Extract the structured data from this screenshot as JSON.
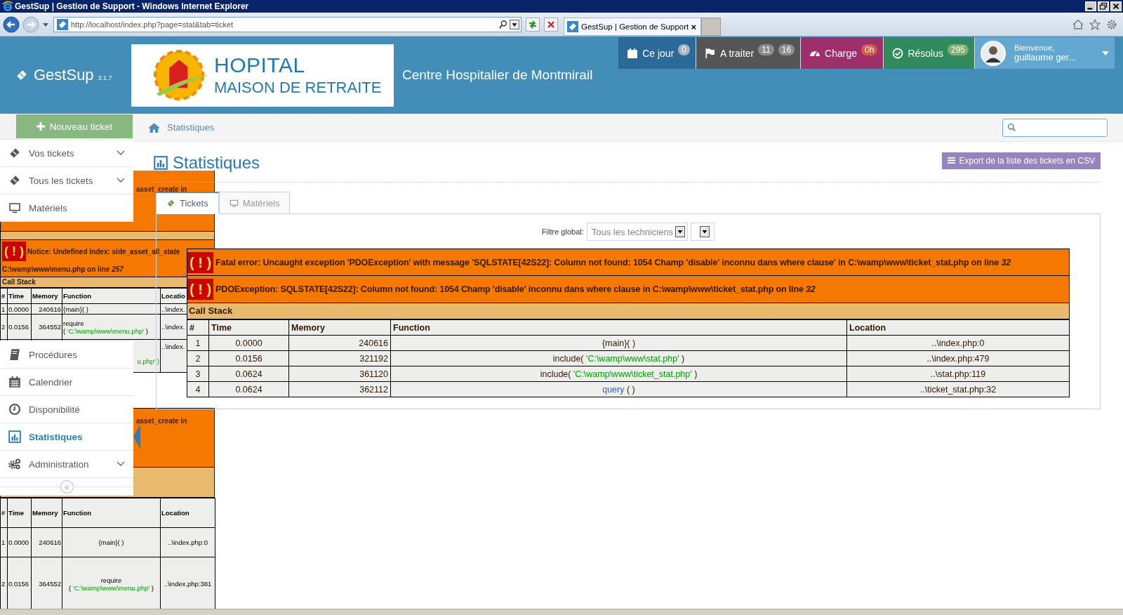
{
  "browser": {
    "title": "GestSup | Gestion de Support - Windows Internet Explorer",
    "address": "http://localhost/index.php?page=stat&tab=ticket",
    "tab": {
      "label": "GestSup | Gestion de Support",
      "close": "×"
    }
  },
  "header": {
    "app_name": "GestSup",
    "version": "3.1.7",
    "logo": {
      "line_1": "HOPITAL",
      "line_2": "MAISON DE RETRAITE"
    },
    "site_title": "Centre Hospitalier de Montmirail"
  },
  "nav": [
    {
      "label": "Ce jour",
      "kind": "calendar",
      "color": "#2b6a98",
      "badges": [
        {
          "text": "0",
          "color": "#a6b4c2"
        }
      ]
    },
    {
      "label": "A traiter",
      "kind": "flag",
      "color": "#555555",
      "badges": [
        {
          "text": "11",
          "color": "#8c8c8c"
        },
        {
          "text": "16",
          "color": "#8c8c8c"
        }
      ]
    },
    {
      "label": "Charge",
      "kind": "gauge",
      "color": "#9e2f6b",
      "badges": [
        {
          "text": "0h",
          "color": "#d15b47"
        }
      ]
    },
    {
      "label": "Résolus",
      "kind": "check",
      "color": "#2f8a5e",
      "badges": [
        {
          "text": "295",
          "color": "#82af6f"
        }
      ]
    }
  ],
  "user": {
    "greeting": "Bienvenue,",
    "name": "guillaume ger..."
  },
  "sidebar": {
    "new_ticket": "Nouveau ticket",
    "items_top": [
      {
        "label": "Vos tickets",
        "kind": "ticket",
        "expandable": true,
        "selected": false
      },
      {
        "label": "Tous les tickets",
        "kind": "ticket",
        "expandable": true,
        "selected": false
      },
      {
        "label": "Matériels",
        "kind": "monitor",
        "expandable": false,
        "selected": false
      }
    ],
    "items_bottom": [
      {
        "label": "Procédures",
        "kind": "book",
        "expandable": false,
        "selected": false
      },
      {
        "label": "Calendrier",
        "kind": "calendar",
        "expandable": false,
        "selected": false
      },
      {
        "label": "Disponibilité",
        "kind": "clock",
        "expandable": false,
        "selected": false
      },
      {
        "label": "Statistiques",
        "kind": "chart",
        "expandable": false,
        "selected": true
      },
      {
        "label": "Administration",
        "kind": "gears",
        "expandable": true,
        "selected": false
      }
    ],
    "collapse": "«"
  },
  "breadcrumb": {
    "link": "Statistiques"
  },
  "page": {
    "title": "Statistiques",
    "export_button": "Export de la liste des tickets en CSV",
    "tabs": [
      {
        "label": "Tickets",
        "kind": "ticket",
        "selected": true
      },
      {
        "label": "Matériels",
        "kind": "monitor",
        "selected": false
      }
    ],
    "filter": {
      "label": "Filtre global:",
      "technician": "Tous les techniciens"
    }
  },
  "error": {
    "messages": [
      {
        "icon": "( ! )",
        "text": "Fatal error: Uncaught exception 'PDOException' with message 'SQLSTATE[42S22]: Column not found: 1054 Champ 'disable' inconnu dans where clause' in C:\\wamp\\www\\ticket_stat.php on line *32*"
      },
      {
        "icon": "( ! )",
        "text": "PDOException: SQLSTATE[42S22]: Column not found: 1054 Champ 'disable' inconnu dans where clause in C:\\wamp\\www\\ticket_stat.php on line *32*"
      }
    ],
    "call_stack_title": "Call Stack",
    "columns": [
      "#",
      "Time",
      "Memory",
      "Function",
      "Location"
    ],
    "rows": [
      {
        "number": "1",
        "time": "0.0000",
        "memory": "240616",
        "function": [
          {
            "kind": "plain",
            "text": "{main}( )"
          }
        ],
        "location": "..\\index.php:0"
      },
      {
        "number": "2",
        "time": "0.0156",
        "memory": "321192",
        "function": [
          {
            "kind": "plain",
            "text": "include( "
          },
          {
            "kind": "argument",
            "text": "'C:\\wamp\\www\\stat.php'"
          },
          {
            "kind": "plain",
            "text": " )"
          }
        ],
        "location": "..\\index.php:479"
      },
      {
        "number": "3",
        "time": "0.0624",
        "memory": "361120",
        "function": [
          {
            "kind": "plain",
            "text": "include( "
          },
          {
            "kind": "argument",
            "text": "'C:\\wamp\\www\\ticket_stat.php'"
          },
          {
            "kind": "plain",
            "text": " )"
          }
        ],
        "location": "..\\stat.php:119"
      },
      {
        "number": "4",
        "time": "0.0624",
        "memory": "362112",
        "function": [
          {
            "kind": "link",
            "text": "query"
          },
          {
            "kind": "plain",
            "text": " ( )"
          }
        ],
        "location": "..\\ticket_stat.php:32"
      }
    ]
  },
  "background_errors": {
    "fragment_1": "asset_create in",
    "notice": {
      "icon": "( ! )",
      "text": "Notice: Undefined index: side_asset_all_state",
      "file": "C:\\wamp\\www\\menu.php on line *257*"
    },
    "call_stack_title": "Call Stack",
    "columns": [
      "#",
      "Time",
      "Memory",
      "Function",
      "Locatio"
    ],
    "rows": [
      {
        "number": "1",
        "time": "0.0000",
        "memory": "240616",
        "function": [
          {
            "kind": "plain",
            "text": "{main}( )"
          }
        ],
        "location": "..\\index."
      },
      {
        "number": "2",
        "time": "0.0156",
        "memory": "364552",
        "function": [
          {
            "kind": "plain",
            "text": "require"
          },
          {
            "kind": "break",
            "text": "( "
          },
          {
            "kind": "argument",
            "text": "'C:\\wamp\\www\\menu.php'"
          },
          {
            "kind": "plain",
            "text": " )"
          }
        ],
        "location": "..\\index."
      }
    ],
    "row_3": {
      "function": "u.php' )",
      "location": "..\\index."
    },
    "fragment_2": "asset_create in",
    "table_2": {
      "columns": [
        "#",
        "Time",
        "Memory",
        "Function",
        "Location"
      ],
      "rows": [
        {
          "number": "1",
          "time": "0.0000",
          "memory": "240616",
          "function": [
            {
              "kind": "plain",
              "text": "{main}( )"
            }
          ],
          "location": "..\\index.php:0"
        },
        {
          "number": "2",
          "time": "0.0156",
          "memory": "364552",
          "function": [
            {
              "kind": "plain",
              "text": "require"
            },
            {
              "kind": "break",
              "text": "( "
            },
            {
              "kind": "argument",
              "text": "'C:\\wamp\\www\\menu.php'"
            },
            {
              "kind": "plain",
              "text": " )"
            }
          ],
          "location": "..\\index.php:381"
        }
      ]
    }
  }
}
